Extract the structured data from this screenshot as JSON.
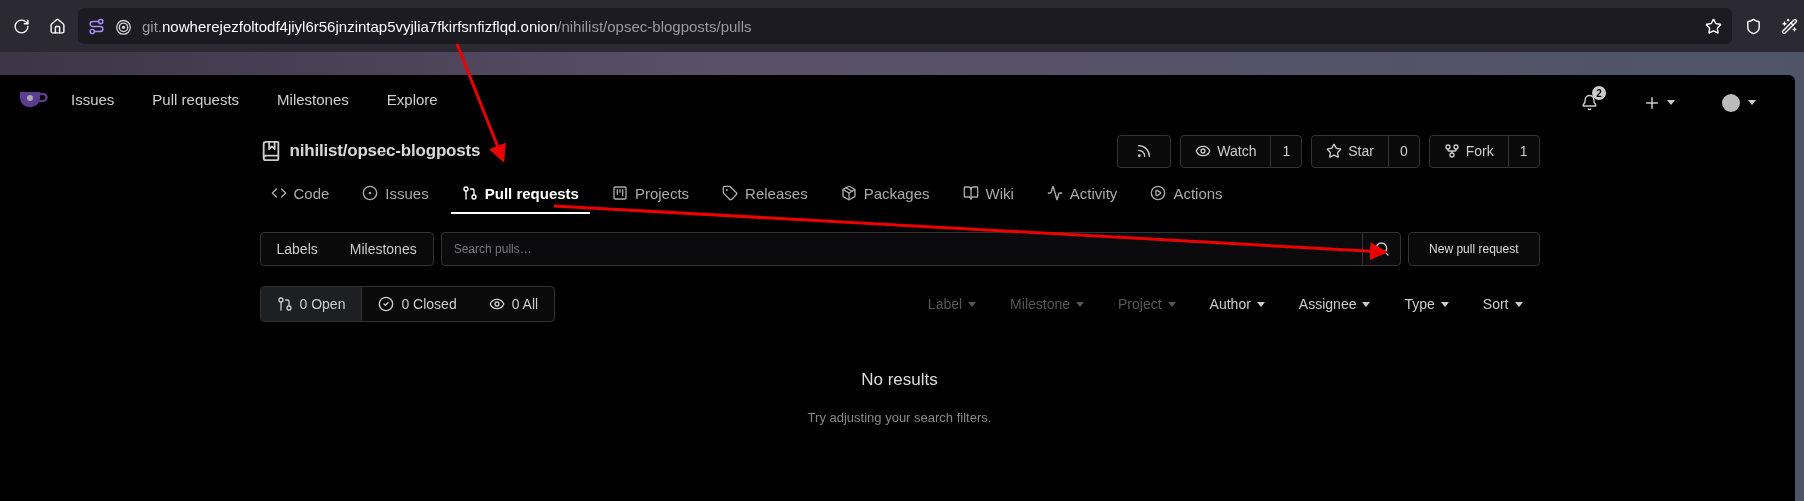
{
  "browser": {
    "url_prefix": "git.",
    "url_host": "nowherejezfoltodf4jiyl6r56jnzintap5vyjlia7fkirfsnfizflqd.onion",
    "url_path": "/nihilist/opsec-blogposts/pulls"
  },
  "navbar": {
    "items": [
      "Issues",
      "Pull requests",
      "Milestones",
      "Explore"
    ],
    "notification_count": "2"
  },
  "repo": {
    "owner": "nihilist",
    "separator": "/",
    "name": "opsec-blogposts"
  },
  "actions": [
    {
      "kind": "rss"
    },
    {
      "kind": "watch",
      "label": "Watch",
      "count": "1"
    },
    {
      "kind": "star",
      "label": "Star",
      "count": "0"
    },
    {
      "kind": "fork",
      "label": "Fork",
      "count": "1"
    }
  ],
  "tabs": [
    {
      "kind": "code",
      "label": "Code",
      "selected": false
    },
    {
      "kind": "issues",
      "label": "Issues",
      "selected": false
    },
    {
      "kind": "pulls",
      "label": "Pull requests",
      "selected": true
    },
    {
      "kind": "projects",
      "label": "Projects",
      "selected": false
    },
    {
      "kind": "releases",
      "label": "Releases",
      "selected": false
    },
    {
      "kind": "packages",
      "label": "Packages",
      "selected": false
    },
    {
      "kind": "wiki",
      "label": "Wiki",
      "selected": false
    },
    {
      "kind": "activity",
      "label": "Activity",
      "selected": false
    },
    {
      "kind": "actions",
      "label": "Actions",
      "selected": false
    }
  ],
  "toolbar": {
    "buttons": [
      "Labels",
      "Milestones"
    ],
    "search": {
      "placeholder": "Search pulls…"
    },
    "new_button": "New pull request"
  },
  "states": [
    {
      "kind": "open",
      "label": "0 Open",
      "selected": true
    },
    {
      "kind": "closed",
      "label": "0 Closed",
      "selected": false
    },
    {
      "kind": "all",
      "label": "0 All",
      "selected": false
    }
  ],
  "filters": [
    {
      "label": "Label",
      "disabled": true
    },
    {
      "label": "Milestone",
      "disabled": true
    },
    {
      "label": "Project",
      "disabled": true
    },
    {
      "label": "Author",
      "disabled": false
    },
    {
      "label": "Assignee",
      "disabled": false
    },
    {
      "label": "Type",
      "disabled": false
    },
    {
      "label": "Sort",
      "disabled": false
    }
  ],
  "empty": {
    "title": "No results",
    "hint": "Try adjusting your search filters."
  }
}
